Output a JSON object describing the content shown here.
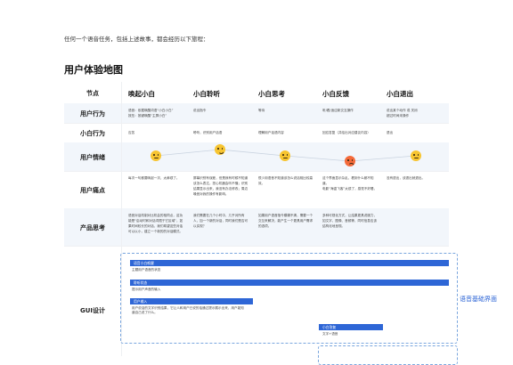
{
  "intro": "任何一个语音任务，包括上述故事，都会经历以下旅程：",
  "title": "用户体验地图",
  "header": {
    "label": "节点",
    "stages": [
      "唤起小白",
      "小白聆听",
      "小白思考",
      "小白反馈",
      "小白退出"
    ]
  },
  "rows": {
    "behavior": {
      "label": "用户行为",
      "cells": [
        "语音：依据唤醒词语“小白小白”\n按压：按键唤醒“主屏小白”",
        "说出指令",
        "等待",
        "听/看/适应新交互操作",
        "说出某个动作 或 关闭\n超过时间未操作"
      ]
    },
    "xiaobai": {
      "label": "小白行为",
      "cells": [
        "应答",
        "聆听，识别用户话语",
        "理解用户话语内容",
        "回应答复（并给出对应建议内容）",
        "退出"
      ]
    },
    "emotion": {
      "label": "用户情绪",
      "moods": [
        "neutral",
        "happy",
        "neutral",
        "sad",
        "neutral"
      ]
    },
    "pain": {
      "label": "用户痛点",
      "cells": [
        "每次一句都要唤起一次，太麻烦了。",
        "屏幕识别有误差，但是我有时候不知道该怎么表达，担心机器会听不懂；识别结果显示出来，我没有办法修改；周边噪音对我的操作有影响。",
        "很少用语音不知道该怎么说话相比较高效。",
        "这个界面显示杂乱，看到什么都不知道。\n电影“海盗飞客”太烦了，感觉不好看。",
        "没有退出，该退出就退出。"
      ]
    },
    "thinking": {
      "label": "产品思考",
      "cells": [
        "语音对话机制对比机会的相同点，这功能是“启动时和对话词限于它区域”，如果时间较长的对话，我们希望这些对话可以以小，建立一个新的的对话模式。",
        "我们需要在几个小时中，几乎对所有人，加一个新的对话，同时我们是否可以实现？",
        "如果用户语音指令模糊不清，需要一个交互来解决，能产生一个更具用户需求的选项。",
        "多种可视化方式，让结果更具说服力，如文字、图像、音频等，同时信息应该结构化地呈现。",
        ""
      ]
    },
    "gui": {
      "label": "GUI设计"
    }
  },
  "gui": {
    "side_label": "语音基础界面",
    "bars": [
      {
        "title": "语音小白唤醒",
        "desc": "主题用户语音的状态"
      },
      {
        "title": "聆听状态",
        "desc": "提示用户声音的输入"
      },
      {
        "title": "用户输入",
        "desc": "用户说话的文字识别结果，它让人和用户已说的话通过提示展示出来，用户能知道自己说了什么。"
      },
      {
        "title": "小白答复",
        "desc": "文字+语音"
      }
    ]
  },
  "colors": {
    "accent": "#2e66d6",
    "happy": "#f7c531",
    "sad": "#f46a3a",
    "shade": "#f2f6fb"
  }
}
